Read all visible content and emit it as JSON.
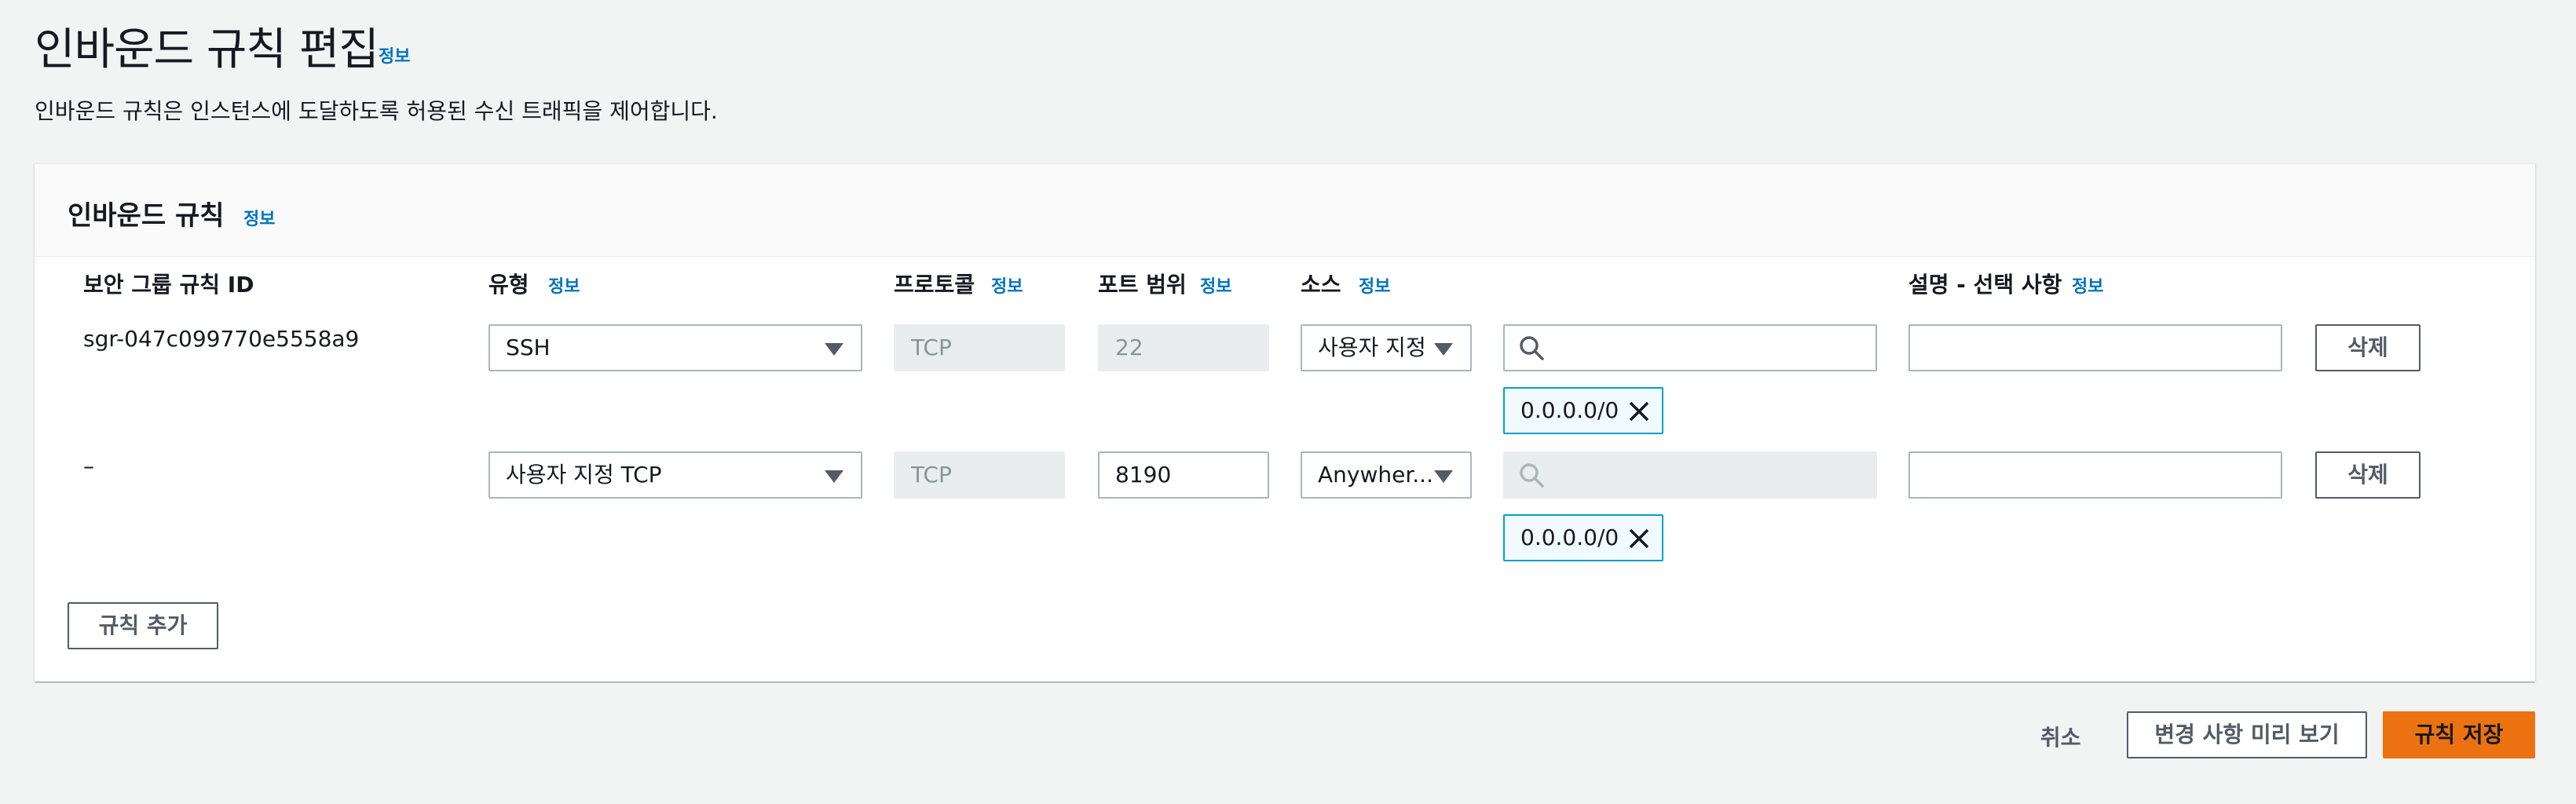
{
  "page": {
    "title": "인바운드 규칙 편집",
    "title_info": "정보",
    "description": "인바운드 규칙은 인스턴스에 도달하도록 허용된 수신 트래픽을 제어합니다."
  },
  "panel": {
    "title": "인바운드 규칙",
    "info": "정보",
    "columns": {
      "rule_id": "보안 그룹 규칙 ID",
      "type": "유형",
      "type_info": "정보",
      "protocol": "프로토콜",
      "protocol_info": "정보",
      "port_range": "포트 범위",
      "port_info": "정보",
      "source": "소스",
      "source_info": "정보",
      "description": "설명 - 선택 사항",
      "description_info": "정보"
    },
    "rules": [
      {
        "rule_id": "sgr-047c099770e5558a9",
        "type": "SSH",
        "protocol": "TCP",
        "port_range": "22",
        "source_type": "사용자 지정",
        "source_search_value": "",
        "source_token": "0.0.0.0/0",
        "description_value": "",
        "delete_label": "삭제"
      },
      {
        "rule_id": "–",
        "type": "사용자 지정 TCP",
        "protocol": "TCP",
        "port_range": "8190",
        "source_type": "Anywher...",
        "source_search_value": "",
        "source_token": "0.0.0.0/0",
        "description_value": "",
        "delete_label": "삭제"
      }
    ],
    "add_rule_label": "규칙 추가"
  },
  "footer": {
    "cancel_label": "취소",
    "preview_label": "변경 사항 미리 보기",
    "save_label": "규칙 저장"
  },
  "colors": {
    "info_link": "#0073bb",
    "primary_button": "#ec7211",
    "token_border": "#00a1c9",
    "token_bg": "#f1faff"
  },
  "icons": [
    "search-icon",
    "close-icon",
    "caret-down-icon"
  ]
}
